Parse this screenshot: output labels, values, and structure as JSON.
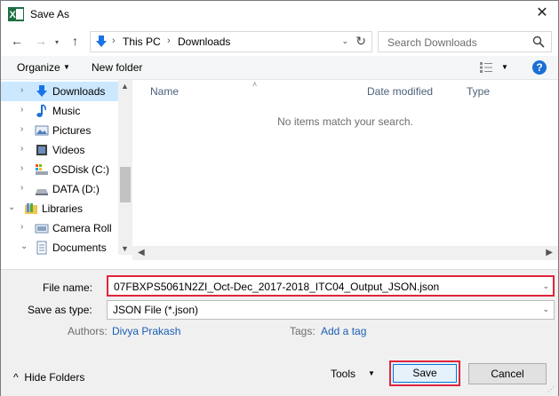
{
  "window": {
    "title": "Save As",
    "close_glyph": "✕",
    "app_icon": "excel-icon"
  },
  "nav": {
    "back": "←",
    "forward": "→",
    "recent": "▾",
    "up": "↑",
    "breadcrumb": [
      "This PC",
      "Downloads"
    ],
    "search_placeholder": "Search Downloads"
  },
  "toolbar": {
    "organize": "Organize",
    "new_folder": "New folder"
  },
  "tree": [
    {
      "label": "Downloads",
      "icon": "download-icon",
      "chevron": "›",
      "selected": true
    },
    {
      "label": "Music",
      "icon": "music-icon",
      "chevron": "›"
    },
    {
      "label": "Pictures",
      "icon": "pictures-icon",
      "chevron": "›"
    },
    {
      "label": "Videos",
      "icon": "videos-icon",
      "chevron": "›"
    },
    {
      "label": "OSDisk (C:)",
      "icon": "osdisk-icon",
      "chevron": "›"
    },
    {
      "label": "DATA (D:)",
      "icon": "drive-icon",
      "chevron": "›"
    },
    {
      "label": "Libraries",
      "icon": "libraries-icon",
      "chevron": "⌄"
    },
    {
      "label": "Camera Roll",
      "icon": "camera-roll-icon",
      "chevron": "›"
    },
    {
      "label": "Documents",
      "icon": "documents-icon",
      "chevron": "⌄"
    }
  ],
  "files": {
    "columns": [
      "Name",
      "Date modified",
      "Type"
    ],
    "empty_message": "No items match your search."
  },
  "form": {
    "file_name_label": "File name:",
    "file_name_value": "07FBXPS5061N2ZI_Oct-Dec_2017-2018_ITC04_Output_JSON.json",
    "save_type_label": "Save as type:",
    "save_type_value": "JSON File (*.json)",
    "authors_label": "Authors:",
    "authors_value": "Divya Prakash",
    "tags_label": "Tags:",
    "tags_value": "Add a tag",
    "hide_folders": "Hide Folders",
    "tools": "Tools",
    "save": "Save",
    "cancel": "Cancel"
  },
  "colors": {
    "highlight_border": "#e0243a",
    "selected_bg": "#cce8ff",
    "link": "#1a5fb4"
  }
}
